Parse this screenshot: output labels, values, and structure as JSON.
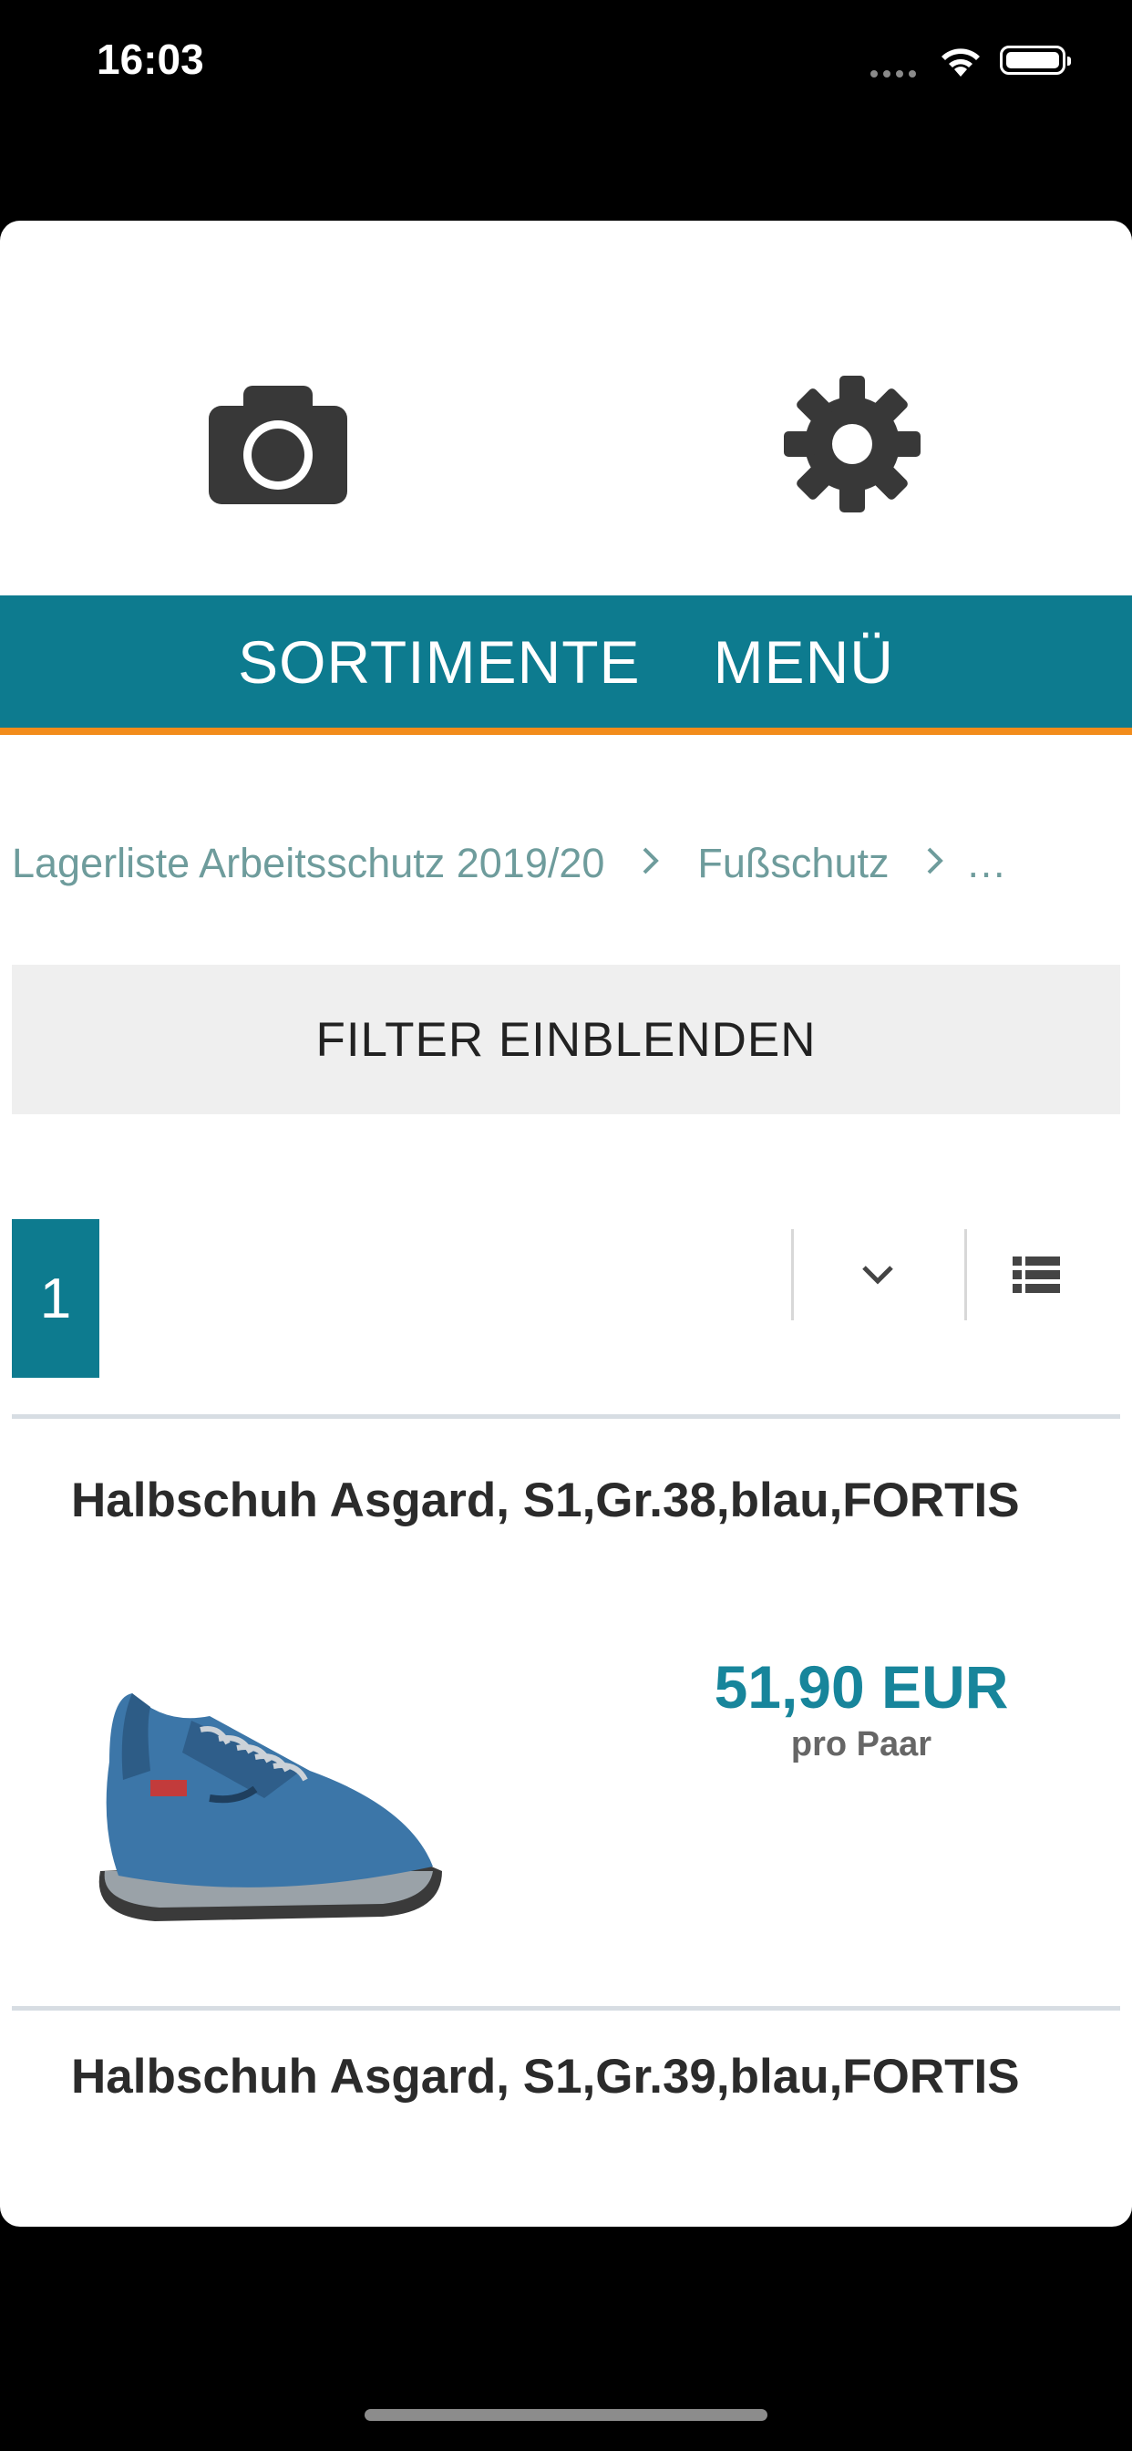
{
  "status_bar": {
    "time": "16:03"
  },
  "toolbar": {
    "camera_icon": "camera-icon",
    "settings_icon": "gear-icon"
  },
  "nav": {
    "items": [
      {
        "label": "SORTIMENTE"
      },
      {
        "label": "MENÜ"
      }
    ]
  },
  "breadcrumb": {
    "items": [
      "Lagerliste Arbeitsschutz 2019/20",
      "Fußschutz",
      "…"
    ]
  },
  "filter": {
    "label": "FILTER EINBLENDEN"
  },
  "pagination": {
    "current_page": "1"
  },
  "products": [
    {
      "title": "Halbschuh Asgard, S1,Gr.38,blau,FORTIS",
      "price": "51,90 EUR",
      "unit": "pro Paar"
    },
    {
      "title": "Halbschuh Asgard, S1,Gr.39,blau,FORTIS"
    }
  ],
  "colors": {
    "accent": "#0d7b8f",
    "nav_border": "#f28c1b",
    "price": "#17859b",
    "breadcrumb": "#6e9c9c"
  }
}
